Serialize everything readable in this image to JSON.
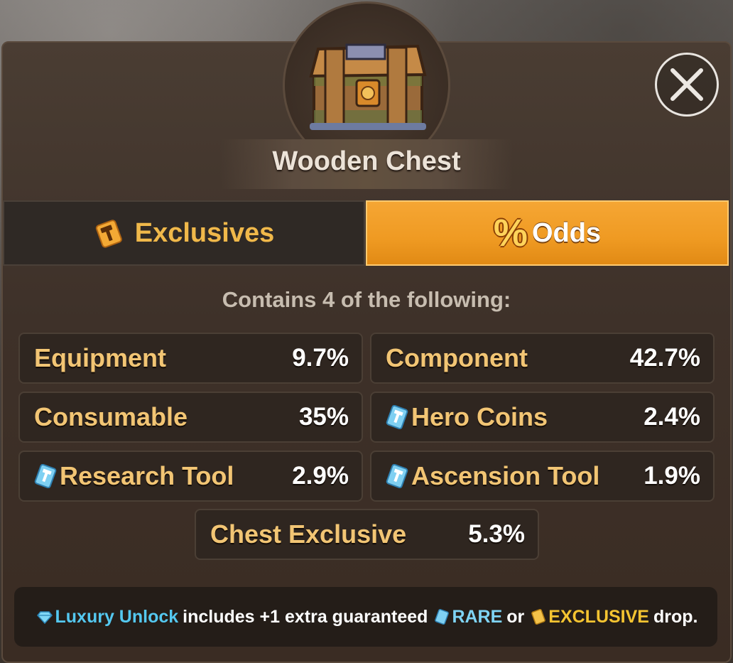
{
  "chest": {
    "title": "Wooden Chest",
    "icon": "wooden-chest-icon"
  },
  "close": {
    "icon": "close-icon"
  },
  "tabs": [
    {
      "label": "Exclusives",
      "icon": "hammer-ticket-icon",
      "active": false
    },
    {
      "label": "Odds",
      "icon": "percent-icon",
      "active": true
    }
  ],
  "odds": {
    "subtitle": "Contains 4 of the following:",
    "items": [
      {
        "label": "Equipment",
        "value": "9.7%"
      },
      {
        "label": "Component",
        "value": "42.7%"
      },
      {
        "label": "Consumable",
        "value": "35%"
      },
      {
        "label": "Hero Coins",
        "value": "2.4%",
        "icon": "rare-tool-icon"
      },
      {
        "label": "Research Tool",
        "value": "2.9%",
        "icon": "rare-tool-icon"
      },
      {
        "label": "Ascension Tool",
        "value": "1.9%",
        "icon": "rare-tool-icon"
      },
      {
        "label": "Chest Exclusive",
        "value": "5.3%"
      }
    ]
  },
  "footer": {
    "luxury": "Luxury Unlock",
    "text1": "includes +1 extra guaranteed",
    "rare": "RARE",
    "or": "or",
    "exclusive": "EXCLUSIVE",
    "text2": "drop."
  },
  "colors": {
    "accent_orange": "#ef9a22",
    "label_gold": "#f2c574",
    "rare_blue": "#54c8f0",
    "exclusive_yellow": "#f5c431"
  }
}
